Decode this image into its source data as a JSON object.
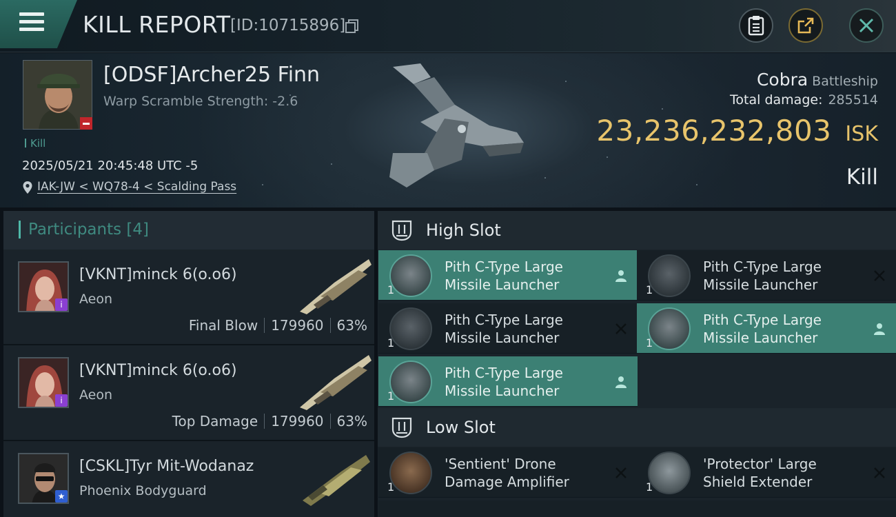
{
  "header": {
    "title": "KILL REPORT",
    "report_id": "[ID:10715896]",
    "buttons": {
      "clipboard": "clipboard-icon",
      "share": "share-icon",
      "close": "close-icon"
    }
  },
  "victim": {
    "name": "[ODSF]Archer25 Finn",
    "warp_scramble": "Warp Scramble Strength: -2.6",
    "kill_tag": "Kill",
    "datetime": "2025/05/21 20:45:48 UTC -5",
    "location": "IAK-JW < WQ78-4 < Scalding Pass",
    "ship_name": "Cobra",
    "ship_class": "Battleship",
    "total_damage_label": "Total damage:",
    "total_damage": "285514",
    "isk_value": "23,236,232,803",
    "isk_unit": "ISK",
    "result": "Kill",
    "security_badge_color": "#c0262b"
  },
  "participants": {
    "label": "Participants",
    "count": "[4]",
    "items": [
      {
        "name": "[VKNT]minck 6(o.o6)",
        "ship": "Aeon",
        "role": "Final Blow",
        "damage": "179960",
        "percent": "63%",
        "badge": "purple"
      },
      {
        "name": "[VKNT]minck 6(o.o6)",
        "ship": "Aeon",
        "role": "Top Damage",
        "damage": "179960",
        "percent": "63%",
        "badge": "purple"
      },
      {
        "name": "[CSKL]Tyr Mit-Wodanaz",
        "ship": "Phoenix Bodyguard",
        "role": "",
        "damage": "",
        "percent": "",
        "badge": "blue"
      }
    ]
  },
  "slots": {
    "high": {
      "label": "High Slot",
      "modules": [
        {
          "line1": "Pith C-Type Large",
          "line2": "Missile Launcher",
          "qty": "1",
          "state": "fitted"
        },
        {
          "line1": "Pith C-Type Large",
          "line2": "Missile Launcher",
          "qty": "1",
          "state": "destroyed"
        },
        {
          "line1": "Pith C-Type Large",
          "line2": "Missile Launcher",
          "qty": "1",
          "state": "destroyed"
        },
        {
          "line1": "Pith C-Type Large",
          "line2": "Missile Launcher",
          "qty": "1",
          "state": "fitted"
        },
        {
          "line1": "Pith C-Type Large",
          "line2": "Missile Launcher",
          "qty": "1",
          "state": "fitted"
        }
      ]
    },
    "low": {
      "label": "Low Slot",
      "modules": [
        {
          "line1": "'Sentient' Drone",
          "line2": "Damage Amplifier",
          "qty": "1",
          "state": "destroyed"
        },
        {
          "line1": "'Protector' Large",
          "line2": "Shield Extender",
          "qty": "1",
          "state": "destroyed"
        }
      ]
    }
  },
  "colors": {
    "accent_teal": "#3c8074",
    "isk_gold": "#e8c46b",
    "participant_label": "#3f8a80"
  }
}
